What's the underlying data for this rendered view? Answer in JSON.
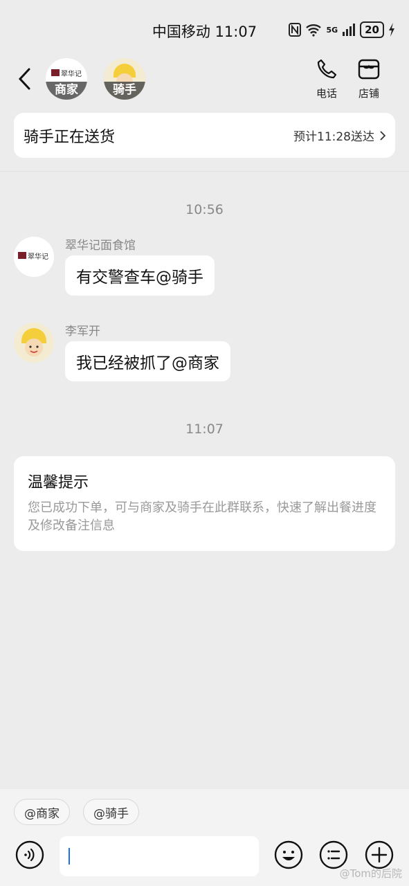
{
  "status_bar": {
    "carrier_time": "中国移动 11:07",
    "signal_label": "5G",
    "battery": "20"
  },
  "header": {
    "merchant_caption": "商家",
    "merchant_logo_text": "翠华记",
    "rider_caption": "骑手",
    "phone_label": "电话",
    "shop_label": "店铺"
  },
  "banner": {
    "title": "骑手正在送货",
    "eta": "预计11:28送达"
  },
  "messages": [
    {
      "time": "10:56",
      "sender": "翠华记面食馆",
      "text": "有交警查车@骑手"
    },
    {
      "sender": "李军开",
      "text": "我已经被抓了@商家"
    },
    {
      "time": "11:07"
    }
  ],
  "tip": {
    "title": "温馨提示",
    "body": "您已成功下单，可与商家及骑手在此群联系，快速了解出餐进度及修改备注信息"
  },
  "quick_chips": [
    "@商家",
    "@骑手"
  ],
  "input": {
    "placeholder": ""
  },
  "watermark": "@Tom的后院",
  "colors": {
    "background": "#ececec",
    "bubble": "#ffffff",
    "caret": "#1a73e8",
    "rider_yellow": "#f5cf3b"
  },
  "icons": [
    "back-arrow-icon",
    "phone-icon",
    "shop-icon",
    "voice-icon",
    "emoji-icon",
    "list-icon",
    "plus-icon"
  ]
}
